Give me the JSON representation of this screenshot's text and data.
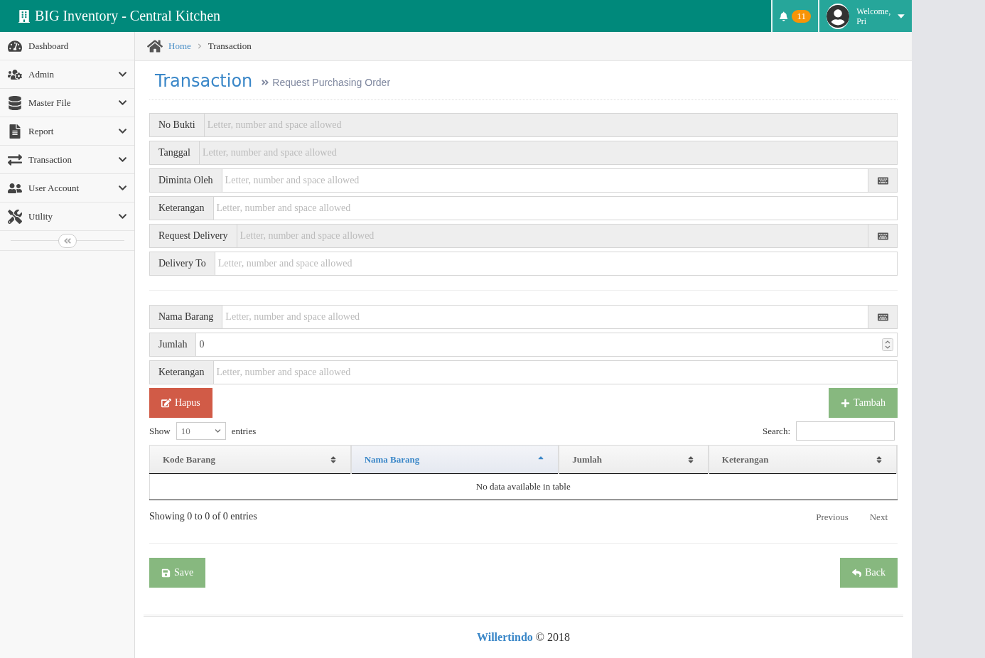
{
  "topbar": {
    "title": "BIG Inventory - Central Kitchen",
    "notifications": "11",
    "welcome": "Welcome,",
    "user": "Pri"
  },
  "sidebar": {
    "items": [
      {
        "label": "Dashboard",
        "kind": "link"
      },
      {
        "label": "Admin",
        "kind": "menu"
      },
      {
        "label": "Master File",
        "kind": "menu"
      },
      {
        "label": "Report",
        "kind": "menu"
      },
      {
        "label": "Transaction",
        "kind": "menu"
      },
      {
        "label": "User Account",
        "kind": "menu"
      },
      {
        "label": "Utility",
        "kind": "menu"
      }
    ]
  },
  "breadcrumb": [
    {
      "label": "Home",
      "kind": "link"
    },
    {
      "label": "Transaction",
      "kind": "current"
    }
  ],
  "page": {
    "title": "Transaction",
    "subtitle": "Request Purchasing Order"
  },
  "header_fields": [
    {
      "label": "No Bukti",
      "placeholder": "Letter, number and space allowed",
      "disabled": true,
      "keyboard": false
    },
    {
      "label": "Tanggal",
      "placeholder": "Letter, number and space allowed",
      "disabled": true,
      "keyboard": false
    },
    {
      "label": "Diminta Oleh",
      "placeholder": "Letter, number and space allowed",
      "disabled": false,
      "keyboard": true
    },
    {
      "label": "Keterangan",
      "placeholder": "Letter, number and space allowed",
      "disabled": false,
      "keyboard": false
    },
    {
      "label": "Request Delivery",
      "placeholder": "Letter, number and space allowed",
      "disabled": true,
      "keyboard": true
    },
    {
      "label": "Delivery To",
      "placeholder": "Letter, number and space allowed",
      "disabled": false,
      "keyboard": false
    }
  ],
  "item_fields": [
    {
      "label": "Nama Barang",
      "placeholder": "Letter, number and space allowed",
      "disabled": false,
      "keyboard": true
    },
    {
      "label": "Jumlah",
      "value": "0",
      "kind": "number",
      "disabled": false,
      "keyboard": false
    },
    {
      "label": "Keterangan",
      "placeholder": "Letter, number and space allowed",
      "disabled": false,
      "keyboard": false
    }
  ],
  "buttons": {
    "delete": "Hapus",
    "add": "Tambah",
    "save": "Save",
    "back": "Back"
  },
  "table": {
    "show_label": "Show",
    "page_size": "10",
    "entries_label": "entries",
    "search_label": "Search:",
    "columns": [
      {
        "label": "Kode Barang",
        "selected": false
      },
      {
        "label": "Nama Barang",
        "selected": true
      },
      {
        "label": "Jumlah",
        "selected": false
      },
      {
        "label": "Keterangan",
        "selected": false
      }
    ],
    "empty": "No data available in table",
    "info": "Showing 0 to 0 of 0 entries",
    "previous": "Previous",
    "next": "Next"
  },
  "footer": {
    "brand": "Willertindo",
    "copyright": "© 2018"
  }
}
